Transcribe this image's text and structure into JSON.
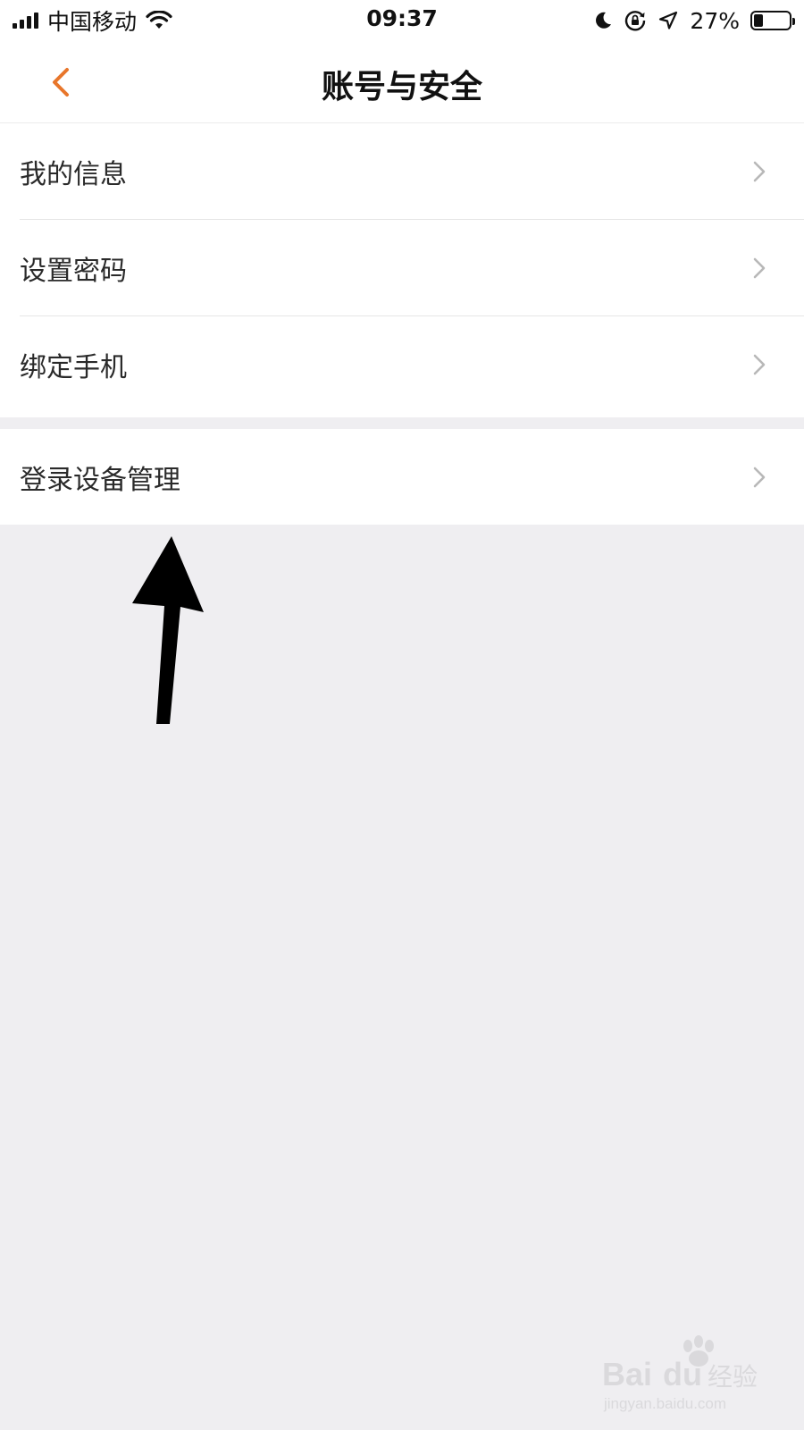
{
  "status_bar": {
    "carrier": "中国移动",
    "time": "09:37",
    "battery_percent": "27%",
    "battery_level": 0.27,
    "icons": [
      "signal-icon",
      "wifi-icon",
      "moon-icon",
      "orientation-lock-icon",
      "location-icon",
      "battery-icon"
    ]
  },
  "nav": {
    "title": "账号与安全",
    "back_icon": "chevron-left-icon",
    "accent_color": "#e8762b"
  },
  "menu_groups": [
    {
      "items": [
        {
          "label": "我的信息"
        },
        {
          "label": "设置密码"
        },
        {
          "label": "绑定手机"
        }
      ]
    },
    {
      "items": [
        {
          "label": "登录设备管理"
        }
      ]
    }
  ],
  "annotation": {
    "type": "arrow-up-icon",
    "color": "#000000"
  },
  "watermark": {
    "brand": "Bai du 经验",
    "url": "jingyan.baidu.com"
  },
  "colors": {
    "background": "#efeef1",
    "surface": "#ffffff",
    "divider": "#e6e6e6",
    "chevron": "#b8b8b8"
  }
}
